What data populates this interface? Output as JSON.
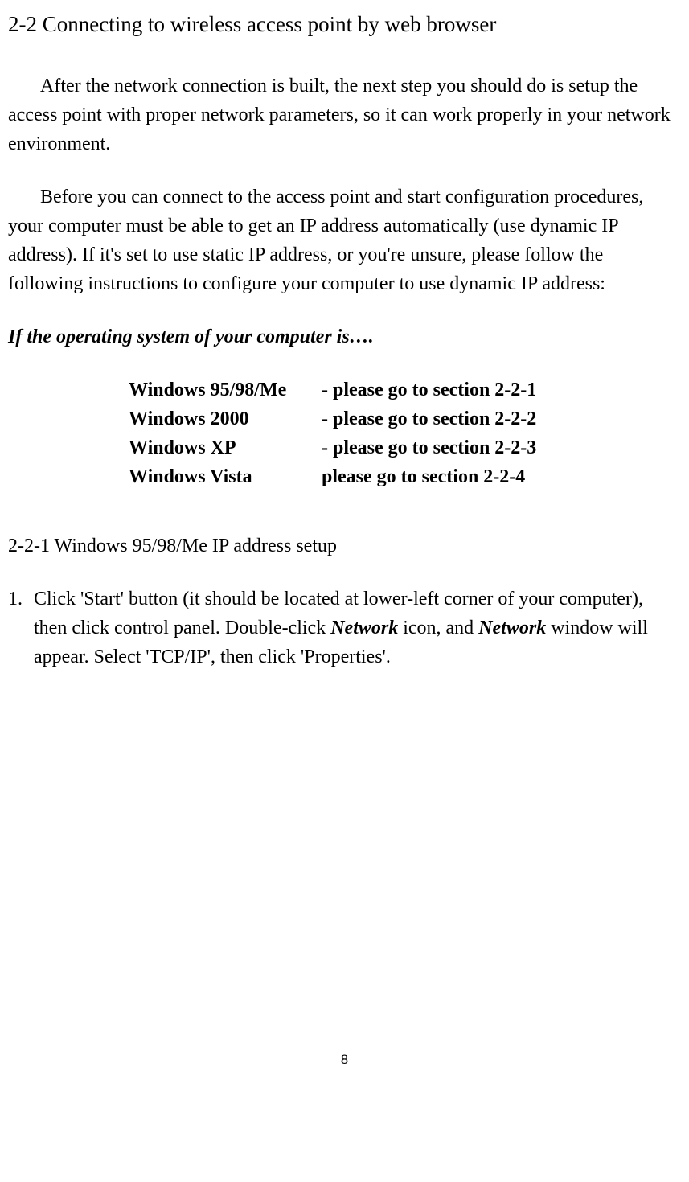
{
  "sectionTitle": "2-2 Connecting to wireless access point by web browser",
  "para1": "After the network connection is built, the next step you should do is setup the access point with proper network parameters, so it can work properly in your network environment.",
  "para2": "Before you can connect to the access point and start configuration procedures, your computer must be able to get an IP address automatically (use dynamic IP address). If it's set to use static IP address, or you're unsure, please follow the following instructions to configure your computer to use dynamic IP address:",
  "osIntro": "If the operating system of your computer is….",
  "osTable": [
    {
      "os": "Windows 95/98/Me",
      "goto": "- please go to section 2-2-1"
    },
    {
      "os": "Windows 2000",
      "goto": "- please go to section 2-2-2"
    },
    {
      "os": "Windows XP",
      "goto": "- please go to section 2-2-3"
    },
    {
      "os": "Windows Vista",
      "goto": "  please go to section 2-2-4"
    }
  ],
  "subsectionTitle": "2-2-1 Windows 95/98/Me IP address setup",
  "step1": {
    "num": "1.",
    "text_a": "Click 'Start' button (it should be located at lower-left corner of your computer), then click control panel. Double-click ",
    "net1": "Network",
    "text_b": " icon, and ",
    "net2": "Network",
    "text_c": " window will appear. Select 'TCP/IP', then click 'Properties'."
  },
  "pageNumber": "8"
}
